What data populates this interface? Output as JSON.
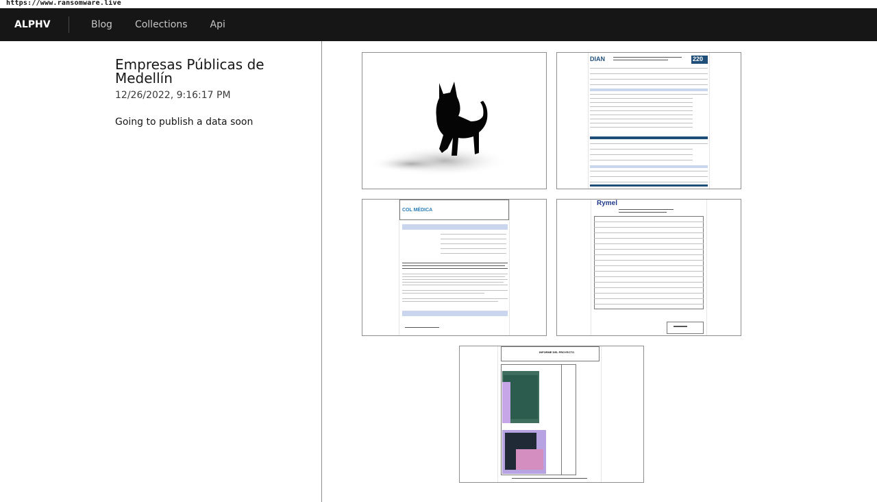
{
  "browser": {
    "url_text": "https://www.ransomware.live"
  },
  "navbar": {
    "brand": "ALPHV",
    "links": [
      "Blog",
      "Collections",
      "Api"
    ]
  },
  "post": {
    "title": "Empresas Públicas de Medellín",
    "date": "12/26/2022, 9:16:17 PM",
    "body": "Going to publish a data soon"
  },
  "images": [
    {
      "name": "cat-silhouette-image",
      "icon": "black-cat"
    },
    {
      "name": "dian-form-220-image",
      "doc_label": "220",
      "brand": "DIAN"
    },
    {
      "name": "colmedica-security-policy-image",
      "brand": "COL MÉDICA"
    },
    {
      "name": "rymel-transformer-test-image",
      "brand": "Rymel"
    },
    {
      "name": "project-report-campaign-image",
      "doc_label": "INFORME DEL PROYECTO"
    }
  ]
}
